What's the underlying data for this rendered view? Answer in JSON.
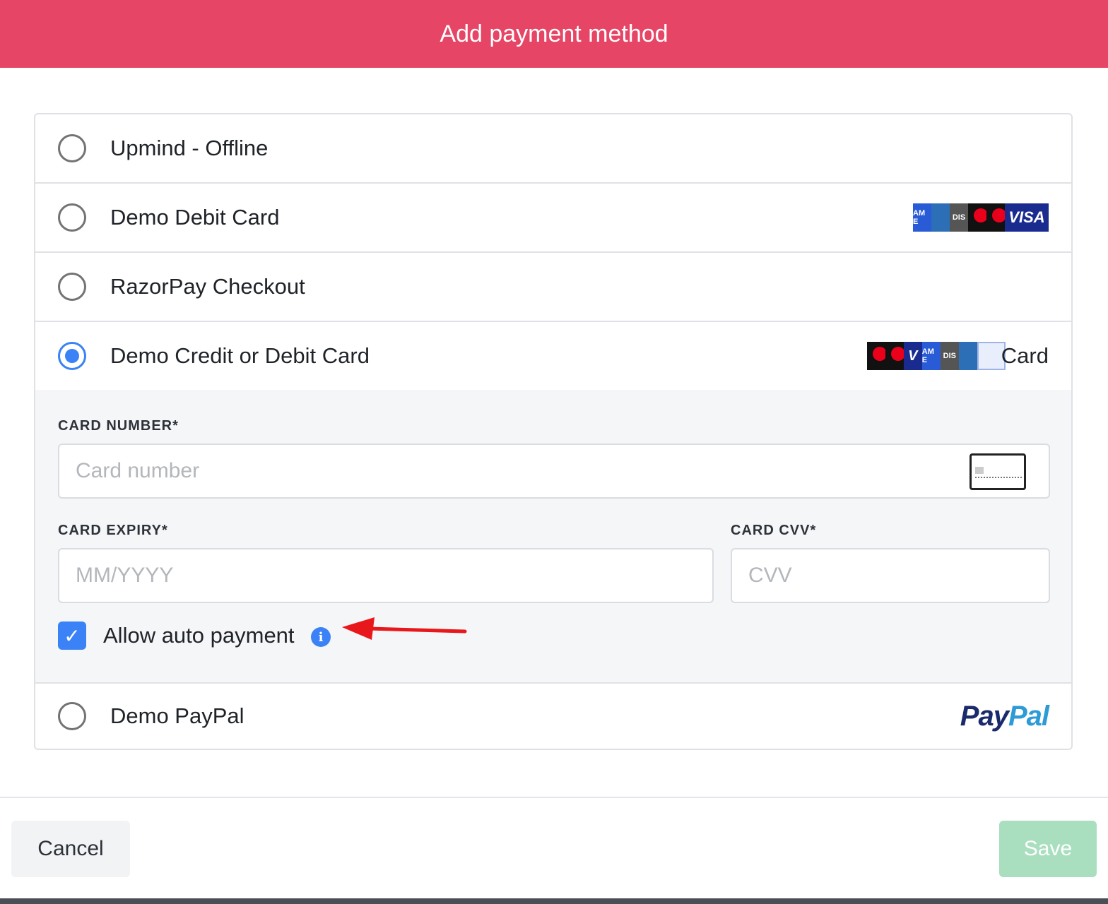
{
  "header": {
    "title": "Add payment method"
  },
  "methods": [
    {
      "label": "Upmind - Offline"
    },
    {
      "label": "Demo Debit Card",
      "brands": [
        "AMEX",
        "DINERS",
        "DIS",
        "MC",
        "MC",
        "VISA"
      ],
      "visa_text": "VISA"
    },
    {
      "label": "RazorPay Checkout"
    },
    {
      "label": "Demo Credit or Debit Card",
      "card_text": "Card"
    },
    {
      "label": "Demo PayPal",
      "paypal_part1": "Pay",
      "paypal_part2": "Pal"
    }
  ],
  "selected_index": 3,
  "brand_text": {
    "amex": "AM E",
    "dis": "DIS",
    "visa_short": "V"
  },
  "form": {
    "card_number_label": "CARD NUMBER*",
    "card_number_placeholder": "Card number",
    "card_expiry_label": "CARD EXPIRY*",
    "card_expiry_placeholder": "MM/YYYY",
    "card_cvv_label": "CARD CVV*",
    "card_cvv_placeholder": "CVV",
    "auto_payment_label": "Allow auto payment",
    "auto_payment_checked": true
  },
  "footer": {
    "cancel_label": "Cancel",
    "save_label": "Save"
  },
  "colors": {
    "header_bg": "#e64565",
    "accent": "#3b82f6",
    "save_bg": "#a9dfbf",
    "arrow": "#e8171b"
  }
}
